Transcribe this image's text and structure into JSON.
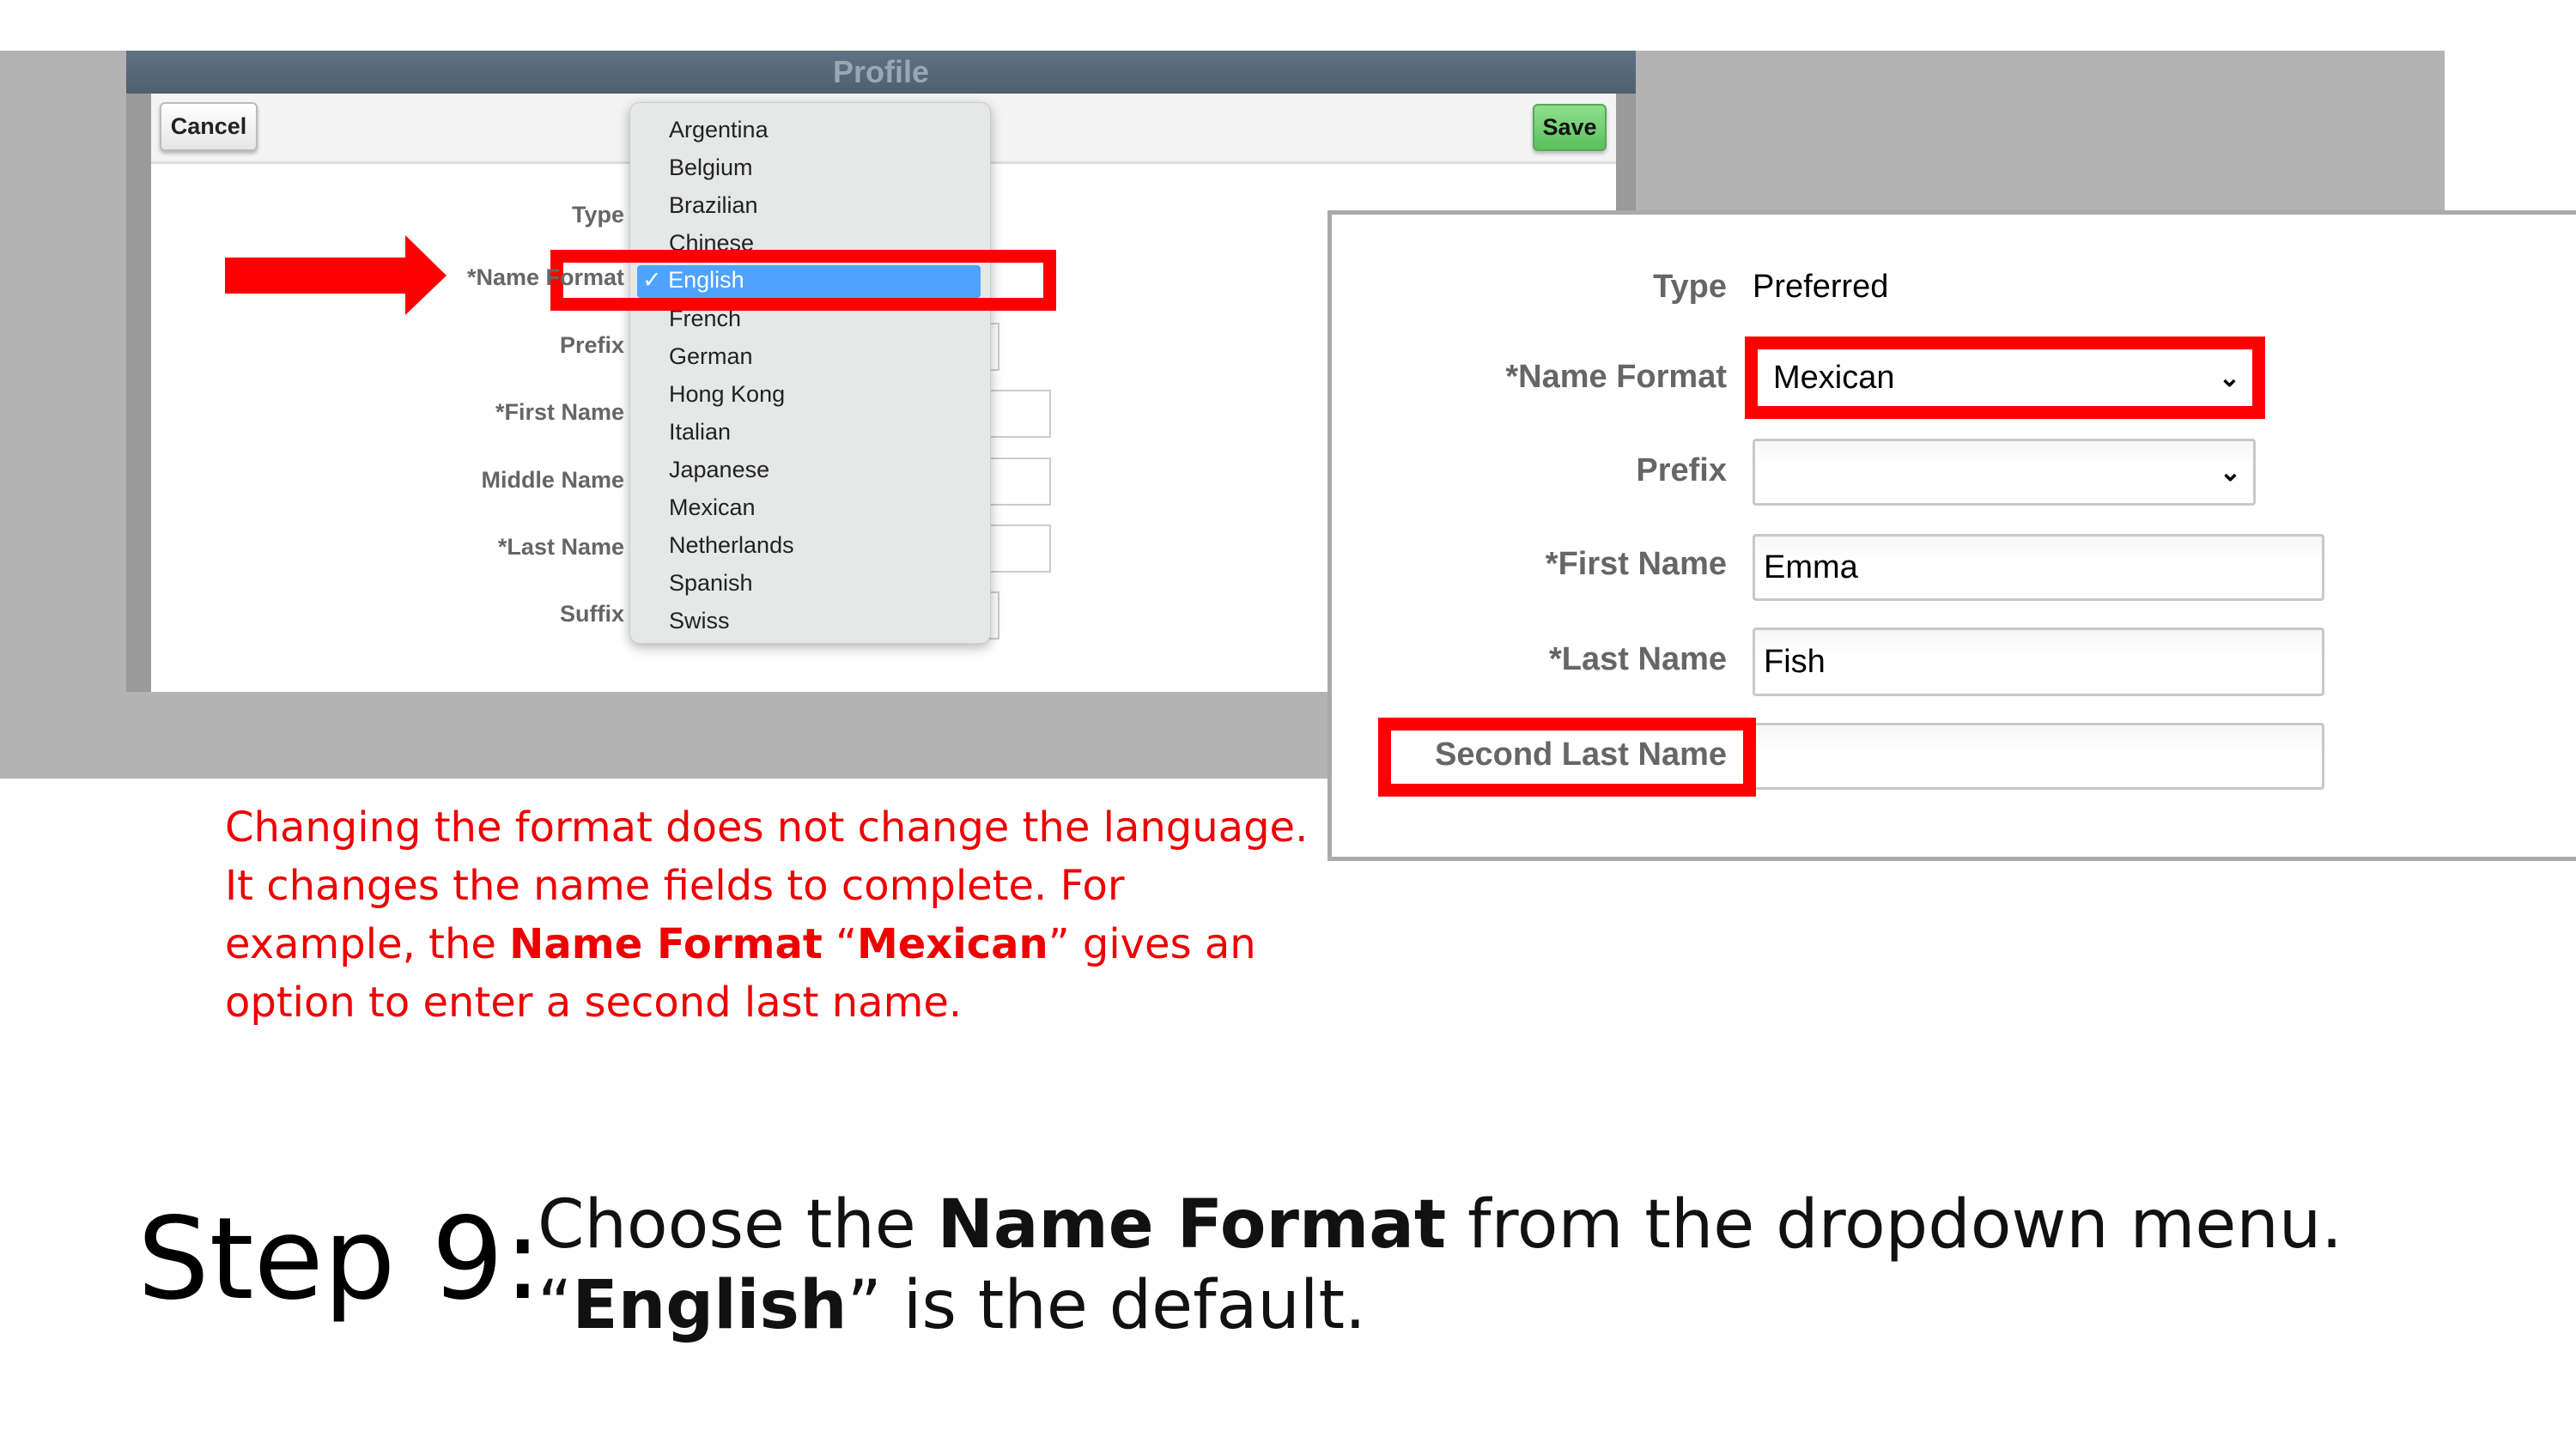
{
  "left_screenshot": {
    "window_title": "Profile",
    "cancel_label": "Cancel",
    "save_label": "Save",
    "labels": [
      "Type",
      "*Name Format",
      "Prefix",
      "*First Name",
      "Middle Name",
      "*Last Name",
      "Suffix"
    ],
    "dropdown_options": [
      "Argentina",
      "Belgium",
      "Brazilian",
      "Chinese",
      "English",
      "French",
      "German",
      "Hong Kong",
      "Italian",
      "Japanese",
      "Mexican",
      "Netherlands",
      "Spanish",
      "Swiss"
    ],
    "selected_option": "✓ English",
    "highlight_color": "#4fa3ff"
  },
  "right_screenshot": {
    "type_label": "Type",
    "type_value": "Preferred",
    "name_format_label": "*Name Format",
    "name_format_value": "Mexican",
    "prefix_label": "Prefix",
    "prefix_value": "",
    "first_name_label": "*First Name",
    "first_name_value": "Emma",
    "last_name_label": "*Last Name",
    "last_name_value": "Fish",
    "second_last_name_label": "Second Last Name",
    "second_last_name_value": ""
  },
  "annotation_color": "#ff0000",
  "note": {
    "part1": "Changing the format does not change the language. It changes the name fields to complete. For example, the ",
    "bold1": "Name Format",
    "part2": " “",
    "bold2": "Mexican",
    "part3": "” gives an option to enter a second last name."
  },
  "step": {
    "label": "Step 9:",
    "text1": "Choose the ",
    "bold1": "Name Format",
    "text2": " from the dropdown menu. “",
    "bold2": "English",
    "text3": "” is the default."
  }
}
